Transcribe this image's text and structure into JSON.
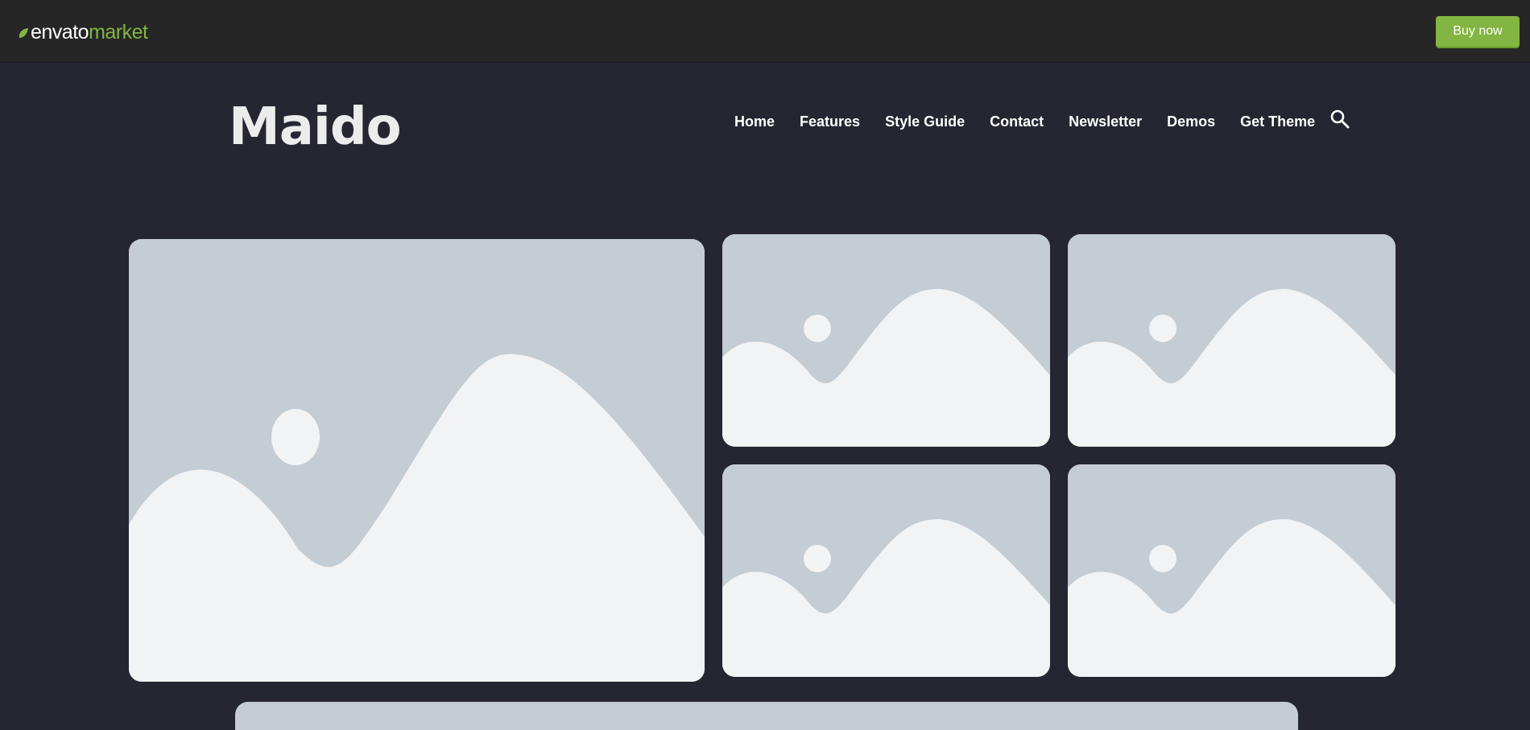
{
  "envato_bar": {
    "logo_word_a": "envato",
    "logo_word_b": "market",
    "buy_button_label": "Buy now",
    "brand_color": "#82b541"
  },
  "header": {
    "site_title": "Maido",
    "nav": [
      {
        "label": "Home"
      },
      {
        "label": "Features"
      },
      {
        "label": "Style Guide"
      },
      {
        "label": "Contact"
      },
      {
        "label": "Newsletter"
      },
      {
        "label": "Demos"
      },
      {
        "label": "Get Theme"
      }
    ],
    "search_icon": "search-icon"
  },
  "gallery": {
    "placeholder_icon": "image-placeholder",
    "placeholder_bg": "#c4ccd4",
    "placeholder_fg": "#f2f3f5"
  },
  "colors": {
    "page_bg": "#252632",
    "topbar_bg": "#262626"
  }
}
